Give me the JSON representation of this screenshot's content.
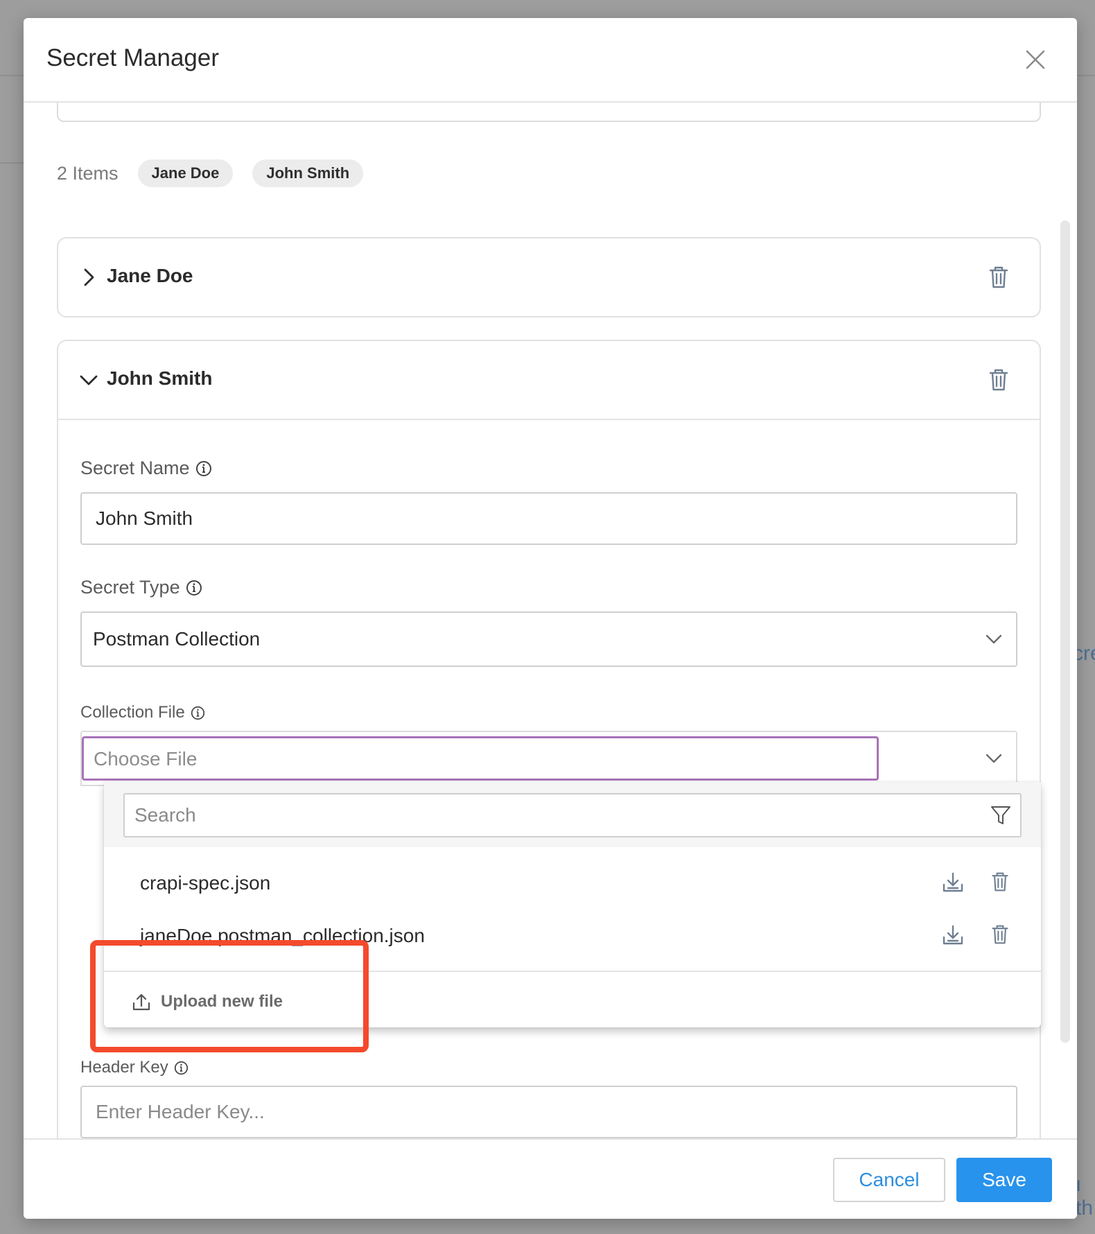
{
  "modal": {
    "title": "Secret Manager"
  },
  "items_bar": {
    "count_label": "2 Items",
    "chips": [
      "Jane Doe",
      "John Smith"
    ]
  },
  "cards": [
    {
      "title": "Jane Doe",
      "expanded": false
    },
    {
      "title": "John Smith",
      "expanded": true
    }
  ],
  "form": {
    "secret_name_label": "Secret Name",
    "secret_name_value": "John Smith",
    "secret_type_label": "Secret Type",
    "secret_type_value": "Postman Collection",
    "collection_file_label": "Collection File",
    "collection_file_placeholder": "Choose File",
    "header_key_label": "Header Key",
    "header_key_placeholder": "Enter Header Key..."
  },
  "file_dropdown": {
    "search_placeholder": "Search",
    "files": [
      "crapi-spec.json",
      "janeDoe.postman_collection.json"
    ],
    "upload_label": "Upload new file"
  },
  "footer": {
    "cancel_label": "Cancel",
    "save_label": "Save"
  },
  "background_fragments": {
    "right_a": "cre",
    "right_b": "ı th"
  },
  "colors": {
    "accent": "#2893ec",
    "focus_border": "#a872b8",
    "highlight": "#f44a2c"
  },
  "icons": [
    "close-icon",
    "chevron-right-icon",
    "chevron-down-icon",
    "trash-icon",
    "info-icon",
    "filter-icon",
    "download-icon",
    "upload-icon"
  ]
}
